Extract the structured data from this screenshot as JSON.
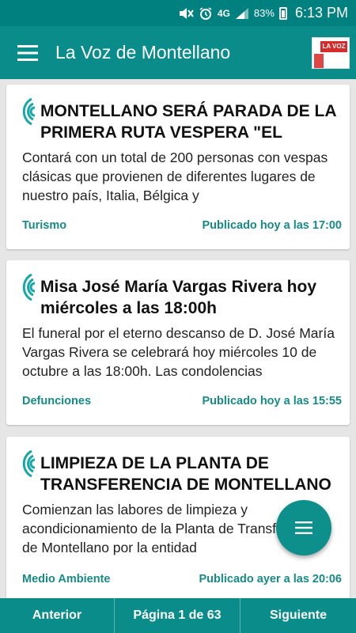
{
  "status_bar": {
    "battery": "83%",
    "network": "4G",
    "time": "6:13 PM"
  },
  "app_bar": {
    "title": "La Voz de Montellano",
    "logo_text": "LA VOZ"
  },
  "articles": [
    {
      "title": "MONTELLANO SERÁ PARADA DE LA PRIMERA RUTA VESPERA \"EL",
      "excerpt": "Contará con un total de 200 personas con vespas clásicas que provienen de diferentes lugares de nuestro país, Italia, Bélgica y",
      "category": "Turismo",
      "published": "Publicado hoy a las 17:00"
    },
    {
      "title": "Misa José María Vargas Rivera hoy miércoles a las 18:00h",
      "excerpt": "El funeral por el eterno descanso de D. José María Vargas Rivera se celebrará hoy miércoles 10 de octubre a las 18:00h. Las condolencias",
      "category": "Defunciones",
      "published": "Publicado hoy a las 15:55"
    },
    {
      "title": "LIMPIEZA DE LA PLANTA DE TRANSFERENCIA DE MONTELLANO",
      "excerpt": "Comienzan las labores de limpieza y acondicionamiento de la Planta de Transferencia de Montellano por la entidad",
      "category": "Medio Ambiente",
      "published": "Publicado ayer a las 20:06"
    }
  ],
  "pager": {
    "prev_label": "Anterior",
    "page_label": "Página 1 de 63",
    "next_label": "Siguiente"
  },
  "colors": {
    "primary": "#0a8c8a",
    "accent_text": "#178a85"
  }
}
